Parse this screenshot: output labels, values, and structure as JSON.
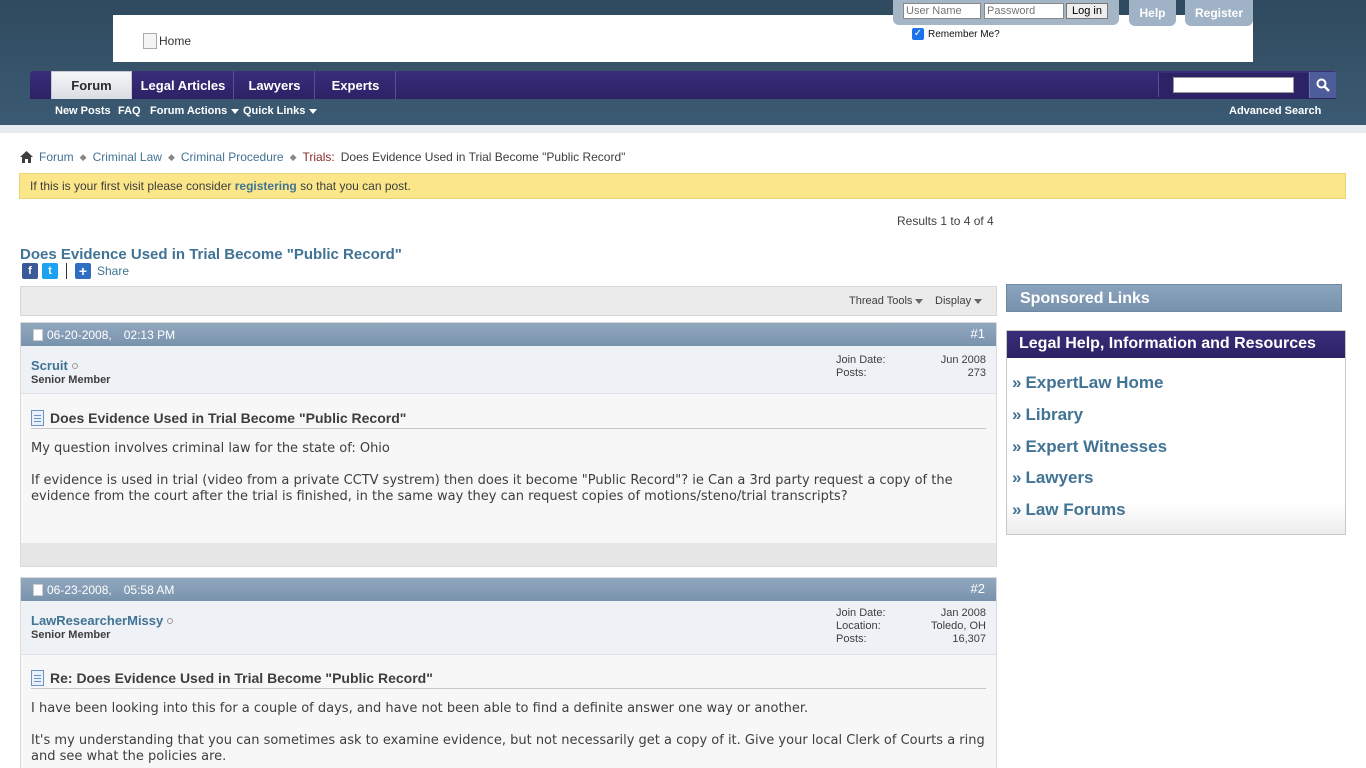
{
  "header": {
    "logo_alt": "Home",
    "username_placeholder": "User Name",
    "password_placeholder": "Password",
    "login_label": "Log in",
    "remember_label": "Remember Me?",
    "help_label": "Help",
    "register_label": "Register"
  },
  "nav": {
    "tabs": [
      "Forum",
      "Legal Articles",
      "Lawyers",
      "Experts"
    ],
    "active_tab": "Forum",
    "sub": [
      "New Posts",
      "FAQ",
      "Forum Actions",
      "Quick Links"
    ],
    "advanced_search": "Advanced Search"
  },
  "breadcrumb": {
    "items": [
      "Forum",
      "Criminal Law",
      "Criminal Procedure",
      "Trials:"
    ],
    "current": "Does Evidence Used in Trial Become \"Public Record\""
  },
  "notice": {
    "before": "If this is your first visit please consider ",
    "link": "registering",
    "after": " so that you can post."
  },
  "results": "Results 1 to 4 of 4",
  "thread": {
    "title": "Does Evidence Used in Trial Become \"Public Record\"",
    "share": "Share",
    "tools": "Thread Tools",
    "display": "Display"
  },
  "posts": [
    {
      "date": "06-20-2008,",
      "time": "02:13 PM",
      "num": "#1",
      "user": "Scruit",
      "user_title": "Senior Member",
      "stats": [
        {
          "label": "Join Date:",
          "value": "Jun 2008"
        },
        {
          "label": "Posts:",
          "value": "273"
        }
      ],
      "title": "Does Evidence Used in Trial Become \"Public Record\"",
      "body": [
        "My question involves criminal law for the state of: Ohio",
        "If evidence is used in trial (video from a private CCTV systrem) then does it become \"Public Record\"? ie Can a 3rd party request a copy of the evidence from the court after the trial is finished, in the same way they can request copies of motions/steno/trial transcripts?"
      ]
    },
    {
      "date": "06-23-2008,",
      "time": "05:58 AM",
      "num": "#2",
      "user": "LawResearcherMissy",
      "user_title": "Senior Member",
      "stats": [
        {
          "label": "Join Date:",
          "value": "Jan 2008"
        },
        {
          "label": "Location:",
          "value": "Toledo, OH"
        },
        {
          "label": "Posts:",
          "value": "16,307"
        }
      ],
      "title": "Re: Does Evidence Used in Trial Become \"Public Record\"",
      "body": [
        "I have been looking into this for a couple of days, and have not been able to find a definite answer one way or another.",
        "It's my understanding that you can sometimes ask to examine evidence, but not necessarily get a copy of it. Give your local Clerk of Courts a ring and see what the policies are."
      ]
    }
  ],
  "sidebar": {
    "sponsored": "Sponsored Links",
    "legal_title": "Legal Help, Information and Resources",
    "links": [
      "ExpertLaw Home",
      "Library",
      "Expert Witnesses",
      "Lawyers",
      "Law Forums"
    ]
  },
  "colors": {
    "link": "#417394",
    "navbar": "#2c2266",
    "notice": "#fbe789"
  }
}
